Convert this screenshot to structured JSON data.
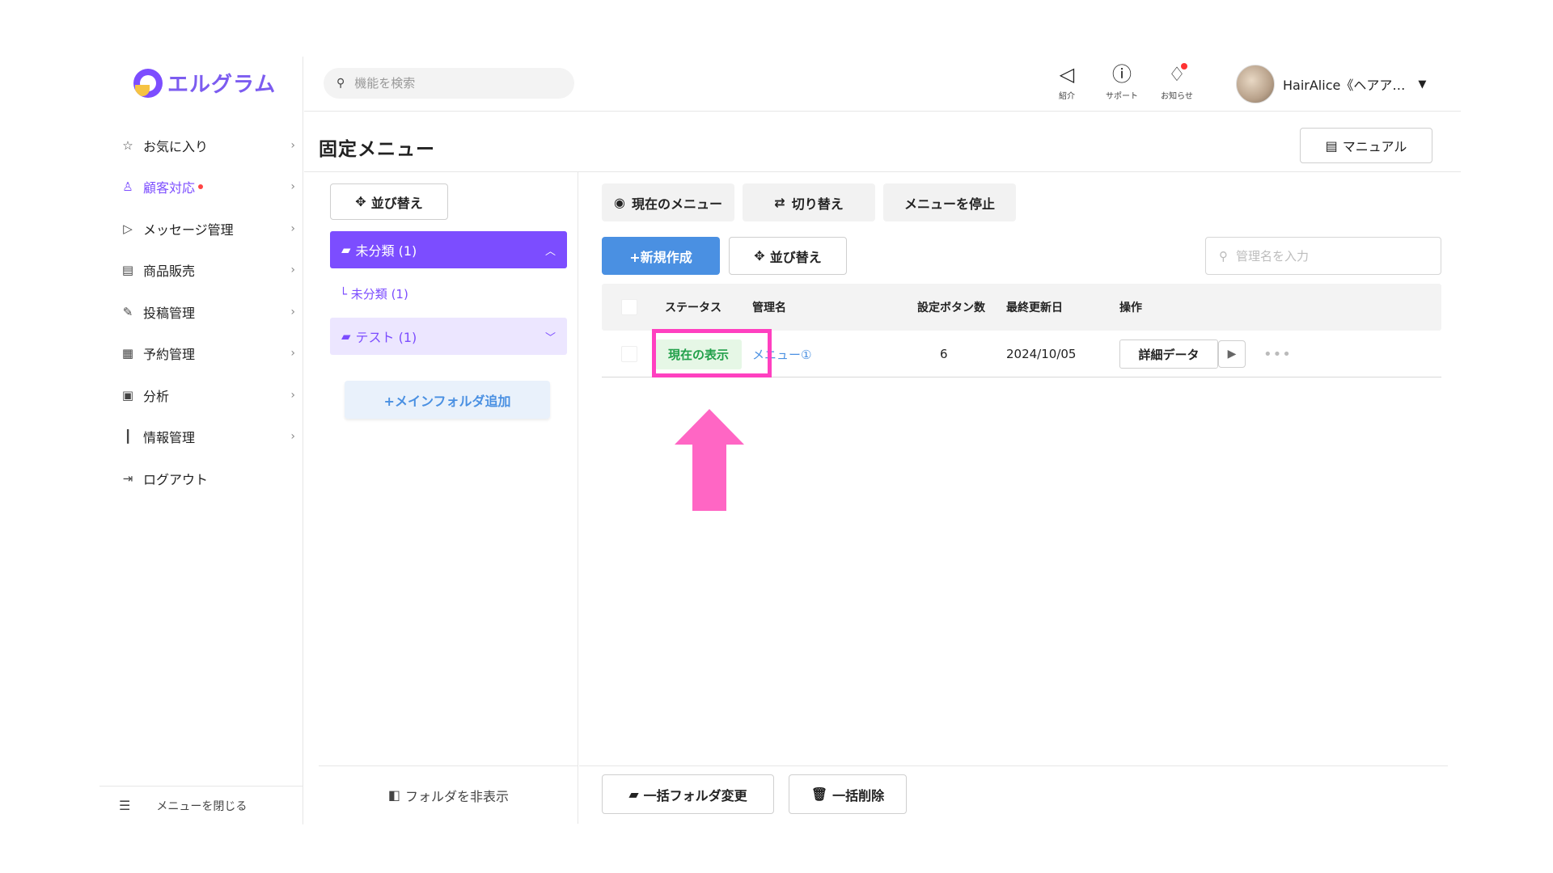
{
  "app": {
    "logo_text": "エルグラム",
    "search_placeholder": "機能を検索"
  },
  "sidebar": {
    "items": [
      {
        "label": "お気に入り",
        "icon": "star-icon"
      },
      {
        "label": "顧客対応",
        "icon": "person-icon",
        "active": true,
        "dot": true
      },
      {
        "label": "メッセージ管理",
        "icon": "send-icon"
      },
      {
        "label": "商品販売",
        "icon": "store-icon"
      },
      {
        "label": "投稿管理",
        "icon": "edit-icon"
      },
      {
        "label": "予約管理",
        "icon": "calendar-icon"
      },
      {
        "label": "分析",
        "icon": "report-icon"
      },
      {
        "label": "情報管理",
        "icon": "bar-chart-icon"
      },
      {
        "label": "ログアウト",
        "icon": "logout-icon"
      }
    ],
    "footer_label": "メニューを閉じる"
  },
  "header": {
    "icons": [
      {
        "label": "紹介",
        "icon": "megaphone-icon"
      },
      {
        "label": "サポート",
        "icon": "help-icon"
      },
      {
        "label": "お知らせ",
        "icon": "bell-icon"
      }
    ],
    "user_name": "HairAlice《ヘアア…"
  },
  "page": {
    "title": "固定メニュー",
    "manual_label": "マニュアル"
  },
  "folders": {
    "sort_label": "並び替え",
    "active_folder": "未分類 (1)",
    "sub_item": "└ 未分類 (1)",
    "inactive_folder": "テスト (1)",
    "add_label": "+メインフォルダ追加",
    "hide_label": "フォルダを非表示"
  },
  "main": {
    "tabs": [
      "現在のメニュー",
      "切り替え",
      "メニューを停止"
    ],
    "new_label": "+新規作成",
    "sort_label": "並び替え",
    "filter_placeholder": "管理名を入力",
    "columns": {
      "status": "ステータス",
      "name": "管理名",
      "buttons": "設定ボタン数",
      "updated": "最終更新日",
      "actions": "操作"
    },
    "rows": [
      {
        "status": "現在の表示",
        "name": "メニュー①",
        "buttons": "6",
        "updated": "2024/10/05",
        "detail": "詳細データ"
      }
    ],
    "bulk_folder": "一括フォルダ変更",
    "bulk_delete": "一括削除"
  },
  "colors": {
    "accent": "#7c4dff",
    "primary_blue": "#4a90e2",
    "status_green": "#22a04a",
    "highlight_pink": "#ff40c0"
  }
}
